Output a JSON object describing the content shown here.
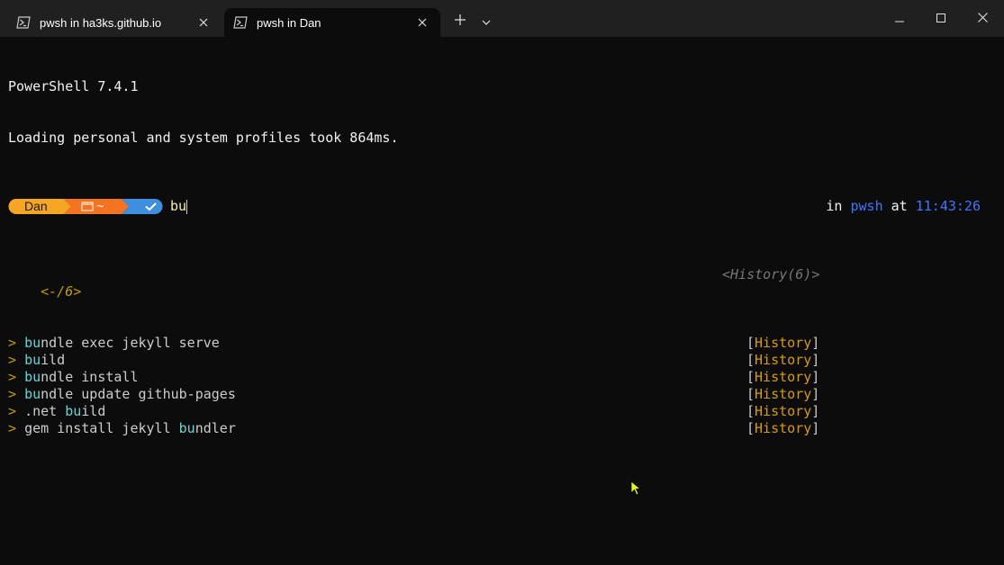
{
  "tabs": [
    {
      "label": "pwsh in ha3ks.github.io",
      "active": false
    },
    {
      "label": "pwsh in Dan",
      "active": true
    }
  ],
  "terminal": {
    "banner_line1": "PowerShell 7.4.1",
    "banner_line2": "Loading personal and system profiles took 864ms.",
    "prompt": {
      "user": "Dan",
      "path": "~",
      "typed": "bu",
      "right_in": "in",
      "right_shell": "pwsh",
      "right_at": "at",
      "right_time": "11:43:26"
    },
    "list_header_left": "<-/6>",
    "list_header_right": "<History(6)>",
    "suggestions": [
      {
        "pre": "",
        "match": "bu",
        "post": "ndle exec jekyll serve",
        "source": "History"
      },
      {
        "pre": "",
        "match": "bu",
        "post": "ild",
        "source": "History"
      },
      {
        "pre": "",
        "match": "bu",
        "post": "ndle install",
        "source": "History"
      },
      {
        "pre": "",
        "match": "bu",
        "post": "ndle update github-pages",
        "source": "History"
      },
      {
        "pre": ".net ",
        "match": "bu",
        "post": "ild",
        "source": "History"
      },
      {
        "pre": "gem install jekyll ",
        "match": "bu",
        "post": "ndler",
        "source": "History"
      }
    ],
    "marker": ">"
  },
  "colors": {
    "user_segment": "#f5a623",
    "path_segment": "#f47421",
    "status_segment": "#3d8fe0",
    "background": "#0c0c0c",
    "titlebar": "#202020"
  }
}
